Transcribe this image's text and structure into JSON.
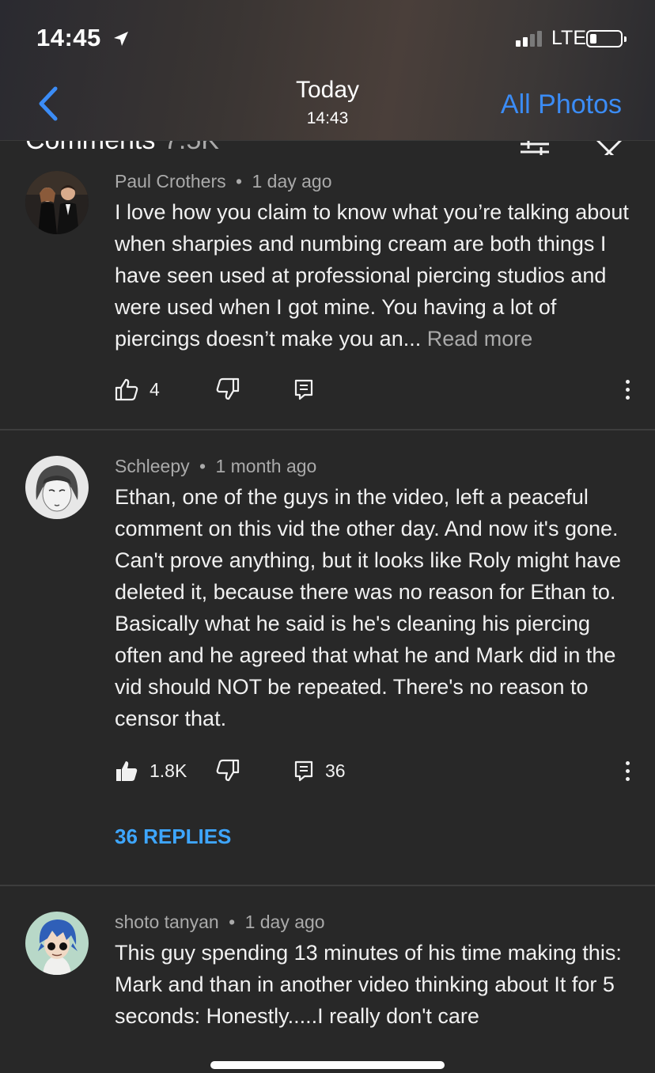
{
  "status_bar": {
    "time": "14:45",
    "network": "LTE"
  },
  "viewer_nav": {
    "title": "Today",
    "subtitle": "14:43",
    "all_photos_label": "All Photos"
  },
  "comments_header": {
    "title": "Comments",
    "count": "7.5K"
  },
  "comments": [
    {
      "author": "Paul Crothers",
      "time": "1 day ago",
      "text": "I love how you claim to know what you’re talking about when sharpies and numbing cream are both things I have seen used at professional piercing studios and were used when I got mine. You having a lot of piercings doesn’t make you an...",
      "read_more": "Read more",
      "likes": "4",
      "liked": false
    },
    {
      "author": "Schleepy",
      "time": "1 month ago",
      "text": "Ethan, one of the guys in the video, left a peaceful comment on this vid the other day. And now it's gone. Can't prove anything, but it looks like Roly might have deleted it, because there was no reason for Ethan to. Basically what he said is he's cleaning his piercing often and he agreed that what he and Mark did in the vid should NOT be repeated. There's no reason to censor that.",
      "likes": "1.8K",
      "liked": true,
      "reply_count": "36",
      "replies_label": "36 REPLIES"
    },
    {
      "author": "shoto tanyan",
      "time": "1 day ago",
      "text_line1": "This guy spending 13 minutes of his time making this:",
      "text_line2": "Mark and than in another video thinking about It for 5 seconds: Honestly.....I really don't care"
    }
  ],
  "meta_separator": "•",
  "colors": {
    "background": "#282828",
    "link_blue": "#3ea6ff",
    "ios_blue": "#3b8cf6",
    "secondary_text": "#aaaaaa"
  },
  "icons": [
    "location-arrow-icon",
    "signal-icon",
    "battery-icon",
    "back-chevron-icon",
    "sort-icon",
    "close-icon",
    "thumbs-up-icon",
    "thumbs-down-icon",
    "reply-icon",
    "more-vert-icon"
  ]
}
